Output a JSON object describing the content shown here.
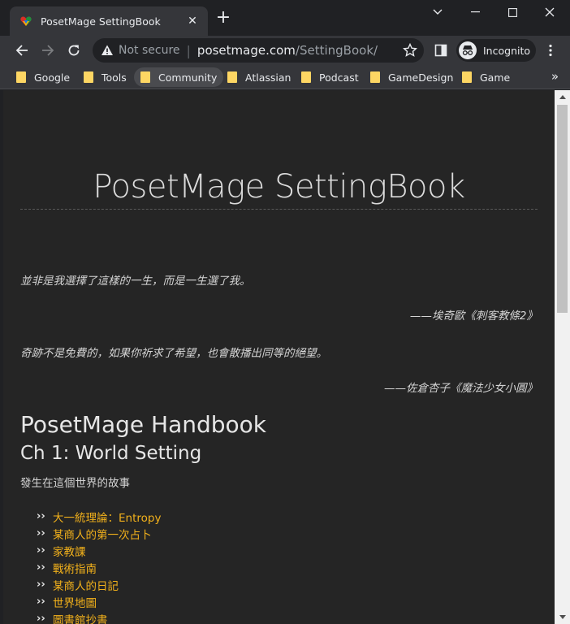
{
  "browser": {
    "tab": {
      "title": "PosetMage SettingBook",
      "favicon": "heart-icon",
      "accent": "#9c6b2e"
    },
    "new_tab_label": "+",
    "window_controls": [
      "minimize",
      "maximize",
      "close"
    ],
    "omnibox": {
      "security_label": "Not secure",
      "host": "posetmage.com",
      "path": "/SettingBook/"
    },
    "profile_label": "Incognito",
    "bookmarks": [
      {
        "label": "Google",
        "icon": "folder-icon"
      },
      {
        "label": "Tools",
        "icon": "folder-icon"
      },
      {
        "label": "Community",
        "icon": "folder-icon"
      },
      {
        "label": "Atlassian",
        "icon": "folder-icon"
      },
      {
        "label": "Podcast",
        "icon": "folder-icon"
      },
      {
        "label": "GameDesign",
        "icon": "folder-icon"
      },
      {
        "label": "Game",
        "icon": "folder-icon"
      }
    ],
    "bookmarks_overflow": "»"
  },
  "page": {
    "title": "PosetMage SettingBook",
    "quotes": [
      {
        "text": "並非是我選擇了這樣的一生，而是一生選了我。",
        "attribution": "——埃奇歐《刺客教條2》"
      },
      {
        "text": "奇跡不是免費的，如果你祈求了希望，也會散播出同等的絕望。",
        "attribution": "——佐倉杏子《魔法少女小圓》"
      }
    ],
    "handbook_heading": "PosetMage Handbook",
    "chapter_heading": "Ch 1: World Setting",
    "chapter_intro": "發生在這個世界的故事",
    "toc_bullet": "››",
    "toc": [
      "大一統理論：Entropy",
      "某商人的第一次占卜",
      "家教課",
      "戰術指南",
      "某商人的日記",
      "世界地圖",
      "圖書館抄書"
    ],
    "colors": {
      "background": "#252525",
      "link": "#f2b11b",
      "text": "#d4d4d4"
    }
  }
}
